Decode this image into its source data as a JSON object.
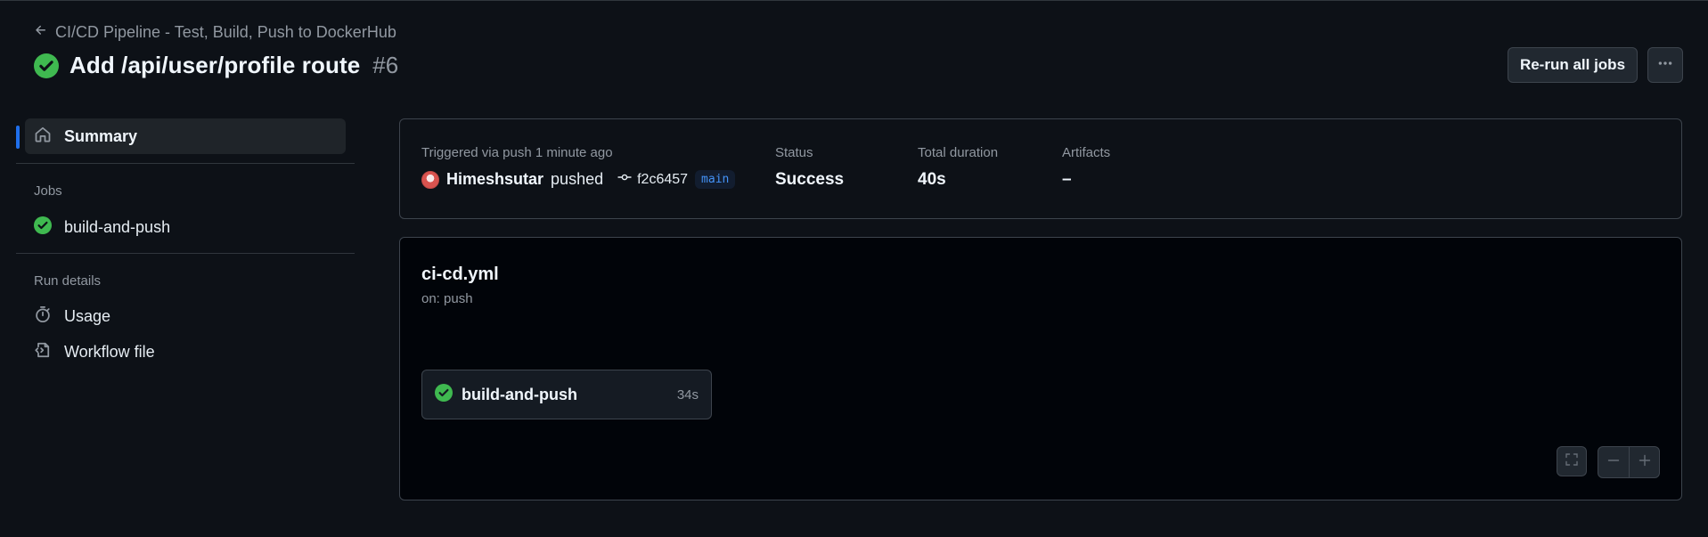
{
  "header": {
    "back_label": "CI/CD Pipeline - Test, Build, Push to DockerHub",
    "run_title": "Add /api/user/profile route",
    "run_number": "#6",
    "rerun_label": "Re-run all jobs"
  },
  "sidebar": {
    "summary_label": "Summary",
    "jobs_heading": "Jobs",
    "jobs": [
      {
        "label": "build-and-push"
      }
    ],
    "run_details_heading": "Run details",
    "usage_label": "Usage",
    "workflow_file_label": "Workflow file"
  },
  "summary": {
    "trigger_label": "Triggered via push 1 minute ago",
    "user": "Himeshsutar",
    "action": "pushed",
    "commit": "f2c6457",
    "branch": "main",
    "status_label": "Status",
    "status_value": "Success",
    "duration_label": "Total duration",
    "duration_value": "40s",
    "artifacts_label": "Artifacts",
    "artifacts_value": "–"
  },
  "graph": {
    "file": "ci-cd.yml",
    "trigger": "on: push",
    "job_name": "build-and-push",
    "job_duration": "34s"
  },
  "colors": {
    "background": "#0d1117",
    "success": "#3fb950",
    "accent": "#1f6feb",
    "branch_text": "#4493f8"
  },
  "icons": {
    "back": "arrow-left-icon",
    "status": "check-circle-fill-icon",
    "more": "kebab-horizontal-icon",
    "summary": "home-icon",
    "usage": "stopwatch-icon",
    "workflow": "file-code-icon",
    "commit": "git-commit-icon",
    "fullscreen": "screen-full-icon",
    "zoom_out": "dash-icon",
    "zoom_in": "plus-icon"
  }
}
